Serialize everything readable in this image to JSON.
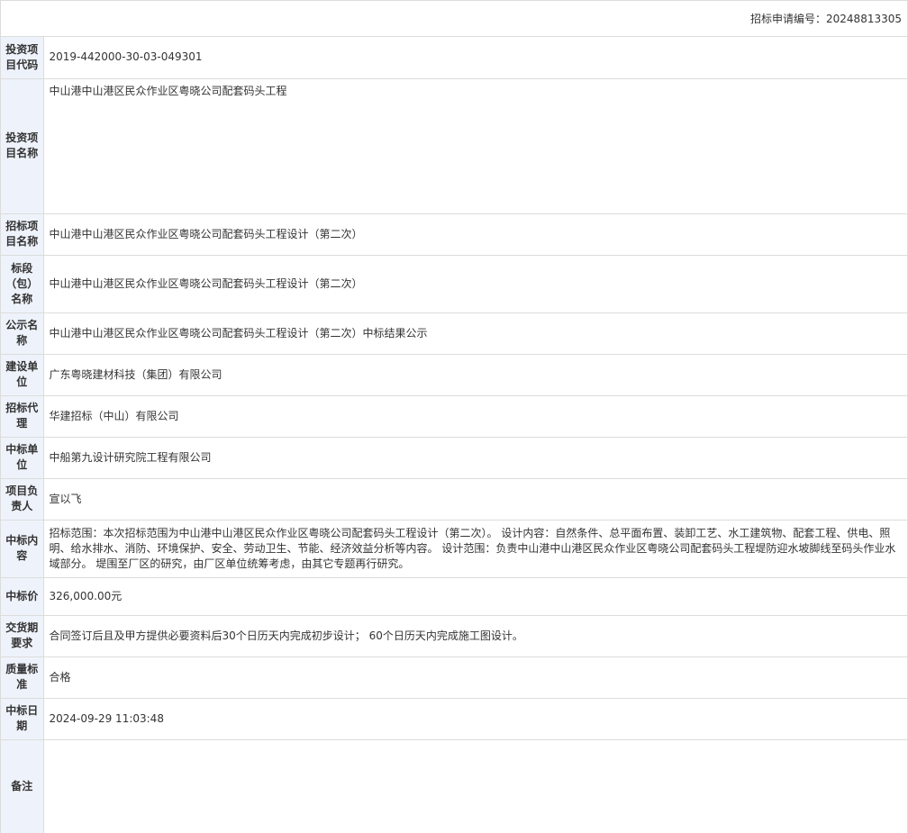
{
  "header": {
    "application_no": "招标申请编号：20248813305"
  },
  "rows": {
    "project_code": {
      "label": "投资项目代码",
      "value": "2019-442000-30-03-049301"
    },
    "project_name": {
      "label": "投资项目名称",
      "value": "中山港中山港区民众作业区粤晓公司配套码头工程"
    },
    "tender_project_name": {
      "label": "招标项目名称",
      "value": "中山港中山港区民众作业区粤晓公司配套码头工程设计（第二次）"
    },
    "section_name": {
      "label": "标段（包）名称",
      "value": "中山港中山港区民众作业区粤晓公司配套码头工程设计（第二次）"
    },
    "notice_name": {
      "label": "公示名称",
      "value": "中山港中山港区民众作业区粤晓公司配套码头工程设计（第二次）中标结果公示"
    },
    "construction_unit": {
      "label": "建设单位",
      "value": "广东粤晓建材科技（集团）有限公司"
    },
    "tender_agent": {
      "label": "招标代理",
      "value": "华建招标（中山）有限公司"
    },
    "winning_unit": {
      "label": "中标单位",
      "value": "中船第九设计研究院工程有限公司"
    },
    "project_leader": {
      "label": "项目负责人",
      "value": "宣以飞"
    },
    "winning_content": {
      "label": "中标内容",
      "value": "招标范围：本次招标范围为中山港中山港区民众作业区粤晓公司配套码头工程设计（第二次）。 设计内容：自然条件、总平面布置、装卸工艺、水工建筑物、配套工程、供电、照明、给水排水、消防、环境保护、安全、劳动卫生、节能、经济效益分析等内容。 设计范围：负责中山港中山港区民众作业区粤晓公司配套码头工程堤防迎水坡脚线至码头作业水域部分。 堤围至厂区的研究，由厂区单位统筹考虑，由其它专题再行研究。"
    },
    "winning_price": {
      "label": "中标价",
      "value": "326,000.00元"
    },
    "delivery_requirement": {
      "label": "交货期要求",
      "value": "合同签订后且及甲方提供必要资料后30个日历天内完成初步设计； 60个日历天内完成施工图设计。"
    },
    "quality_standard": {
      "label": "质量标准",
      "value": "合格"
    },
    "winning_date": {
      "label": "中标日期",
      "value": "2024-09-29 11:03:48"
    },
    "remark": {
      "label": "备注",
      "value": ""
    }
  },
  "colors": {
    "label_background": "#eef3fb",
    "border": "#dcdcdc",
    "text": "#333333"
  }
}
